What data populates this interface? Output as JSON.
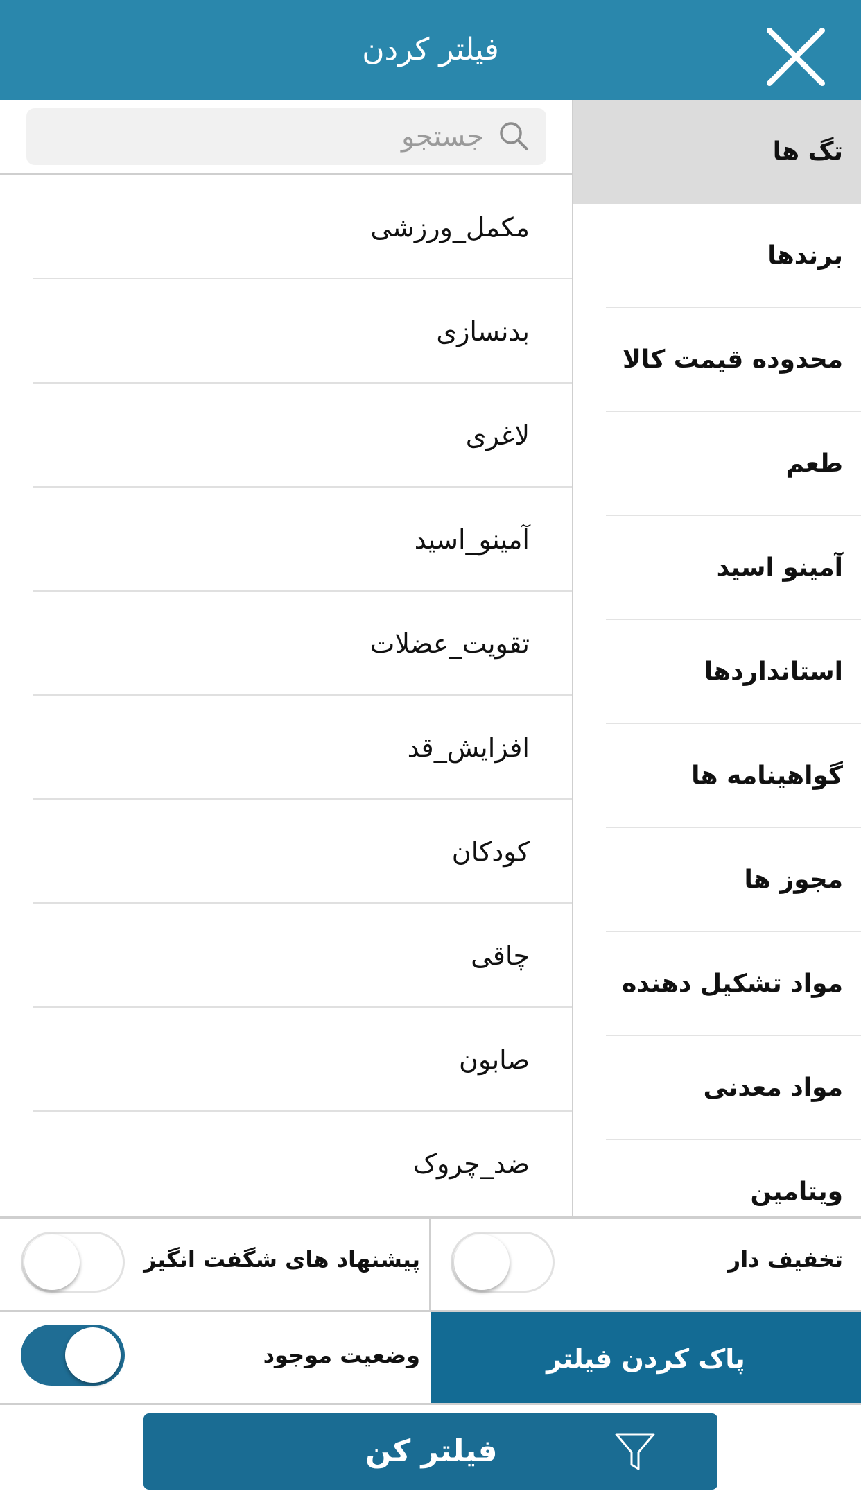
{
  "header": {
    "title": "فیلتر کردن",
    "close_icon": "close-icon"
  },
  "search": {
    "placeholder": "جستجو",
    "value": ""
  },
  "categories": [
    {
      "label": "تگ ها",
      "active": true
    },
    {
      "label": "برندها"
    },
    {
      "label": "محدوده قیمت کالا"
    },
    {
      "label": "طعم"
    },
    {
      "label": "آمینو اسید"
    },
    {
      "label": "استانداردها"
    },
    {
      "label": "گواهینامه ها"
    },
    {
      "label": "مجوز ها"
    },
    {
      "label": "مواد تشکیل دهنده"
    },
    {
      "label": "مواد معدنی"
    },
    {
      "label": "ویتامین"
    }
  ],
  "tags": [
    {
      "label": "مکمل_ورزشی"
    },
    {
      "label": "بدنسازی"
    },
    {
      "label": "لاغری"
    },
    {
      "label": "آمینو_اسید"
    },
    {
      "label": "تقویت_عضلات"
    },
    {
      "label": "افزایش_قد"
    },
    {
      "label": "کودکان"
    },
    {
      "label": "چاقی"
    },
    {
      "label": "صابون"
    },
    {
      "label": "ضد_چروک"
    }
  ],
  "options": {
    "discounted": {
      "label": "تخفیف دار",
      "on": false
    },
    "amazing_offers": {
      "label": "پیشنهاد های شگفت انگیز",
      "on": false
    },
    "in_stock": {
      "label": "وضعیت موجود",
      "on": true
    }
  },
  "buttons": {
    "clear_filter": "پاک کردن فیلتر",
    "apply_filter": "فیلتر کن"
  },
  "colors": {
    "header": "#2a87ac",
    "primary_button": "#1a6c93",
    "toggle_on": "#1f6d94",
    "active_category": "#dcdcdc"
  }
}
